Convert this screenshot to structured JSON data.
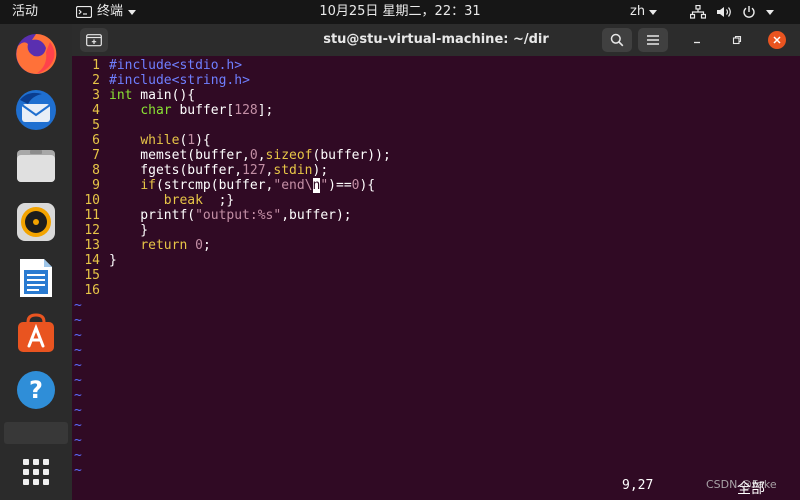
{
  "topbar": {
    "activities": "活动",
    "app_name": "终端",
    "clock": "10月25日 星期二，22：31",
    "lang": "zh",
    "icons": [
      "network-icon",
      "volume-icon",
      "power-icon"
    ]
  },
  "dock": {
    "items": [
      "firefox-icon",
      "thunderbird-icon",
      "files-icon",
      "rhythmbox-icon",
      "libreoffice-writer-icon",
      "software-center-icon",
      "help-icon",
      "show-apps-icon"
    ]
  },
  "window": {
    "title": "stu@stu-virtual-machine: ~/dir",
    "buttons": [
      "new-tab-icon",
      "search-icon",
      "hamburger-menu-icon",
      "minimize-icon",
      "maximize-icon",
      "close-icon"
    ]
  },
  "editor": {
    "line_numbers": [
      "1",
      "2",
      "3",
      "4",
      "5",
      "6",
      "7",
      "8",
      "9",
      "10",
      "11",
      "12",
      "13",
      "14",
      "15",
      "16"
    ],
    "lines": [
      [
        "#include",
        "<stdio.h>"
      ],
      [
        "#include",
        "<string.h>"
      ],
      [
        "int",
        " main(){"
      ],
      [
        "    ",
        "char",
        " buffer[",
        "128",
        "];"
      ],
      [
        ""
      ],
      [
        "    ",
        "while",
        "(",
        "1",
        "){"
      ],
      [
        "    memset(buffer,",
        "0",
        ",",
        "sizeof",
        "(buffer));"
      ],
      [
        "    fgets(buffer,",
        "127",
        ",",
        "stdin",
        ");"
      ],
      [
        "    ",
        "if",
        "(strcmp(buffer,",
        "\"end\\",
        "n",
        "\"",
        ")==",
        "0",
        "){"
      ],
      [
        "       ",
        "break",
        "  ;}"
      ],
      [
        "    printf(",
        "\"output:%s\"",
        ",buffer);"
      ],
      [
        "    }"
      ],
      [
        "    ",
        "return",
        " ",
        "0",
        ";"
      ],
      [
        "}"
      ],
      [
        ""
      ],
      [
        ""
      ]
    ],
    "tilde": "~",
    "tilde_count": 12
  },
  "status": {
    "cursor_position": "9,27",
    "mode": "全部",
    "watermark": "CSDN @Fake"
  }
}
